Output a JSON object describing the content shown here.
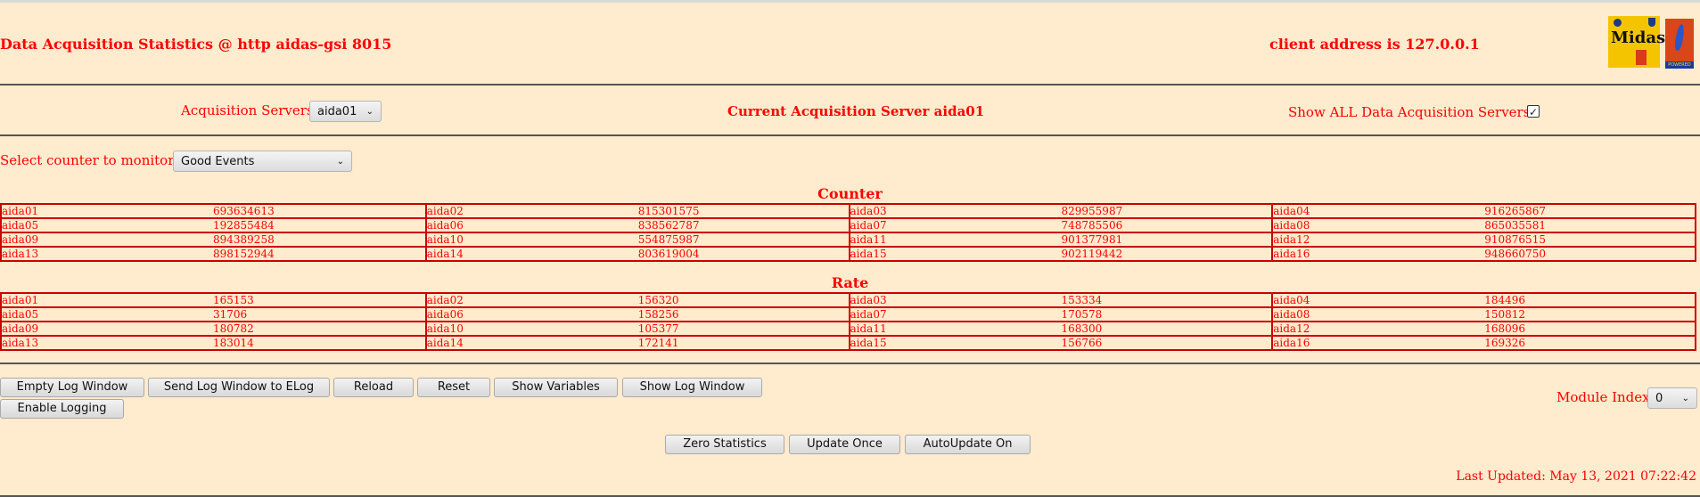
{
  "header": {
    "title": "Data Acquisition Statistics @ http aidas-gsi 8015",
    "client": "client address is 127.0.0.1",
    "logo_midas": "Midas",
    "logo_tcl": "TCL POWERED"
  },
  "servers": {
    "label": "Acquisition Servers",
    "selected": "aida01",
    "current": "Current Acquisition Server aida01",
    "show_all_label": "Show ALL Data Acquisition Servers?",
    "show_all_checked": true
  },
  "counter_select": {
    "label": "Select counter to monitor",
    "selected": "Good Events"
  },
  "counter": {
    "title": "Counter",
    "rows": [
      [
        [
          "aida01",
          "693634613"
        ],
        [
          "aida02",
          "815301575"
        ],
        [
          "aida03",
          "829955987"
        ],
        [
          "aida04",
          "916265867"
        ]
      ],
      [
        [
          "aida05",
          "192855484"
        ],
        [
          "aida06",
          "838562787"
        ],
        [
          "aida07",
          "748785506"
        ],
        [
          "aida08",
          "865035581"
        ]
      ],
      [
        [
          "aida09",
          "894389258"
        ],
        [
          "aida10",
          "554875987"
        ],
        [
          "aida11",
          "901377981"
        ],
        [
          "aida12",
          "910876515"
        ]
      ],
      [
        [
          "aida13",
          "898152944"
        ],
        [
          "aida14",
          "803619004"
        ],
        [
          "aida15",
          "902119442"
        ],
        [
          "aida16",
          "948660750"
        ]
      ]
    ]
  },
  "rate": {
    "title": "Rate",
    "rows": [
      [
        [
          "aida01",
          "165153"
        ],
        [
          "aida02",
          "156320"
        ],
        [
          "aida03",
          "153334"
        ],
        [
          "aida04",
          "184496"
        ]
      ],
      [
        [
          "aida05",
          "31706"
        ],
        [
          "aida06",
          "158256"
        ],
        [
          "aida07",
          "170578"
        ],
        [
          "aida08",
          "150812"
        ]
      ],
      [
        [
          "aida09",
          "180782"
        ],
        [
          "aida10",
          "105377"
        ],
        [
          "aida11",
          "168300"
        ],
        [
          "aida12",
          "168096"
        ]
      ],
      [
        [
          "aida13",
          "183014"
        ],
        [
          "aida14",
          "172141"
        ],
        [
          "aida15",
          "156766"
        ],
        [
          "aida16",
          "169326"
        ]
      ]
    ]
  },
  "buttons": {
    "empty_log": "Empty Log Window",
    "send_log": "Send Log Window to ELog",
    "reload": "Reload",
    "reset": "Reset",
    "show_vars": "Show Variables",
    "show_log": "Show Log Window",
    "enable_logging": "Enable Logging",
    "zero_stats": "Zero Statistics",
    "update_once": "Update Once",
    "autoupdate": "AutoUpdate On"
  },
  "module": {
    "label": "Module Index",
    "selected": "0"
  },
  "last_updated": "Last Updated: May 13, 2021 07:22:42"
}
